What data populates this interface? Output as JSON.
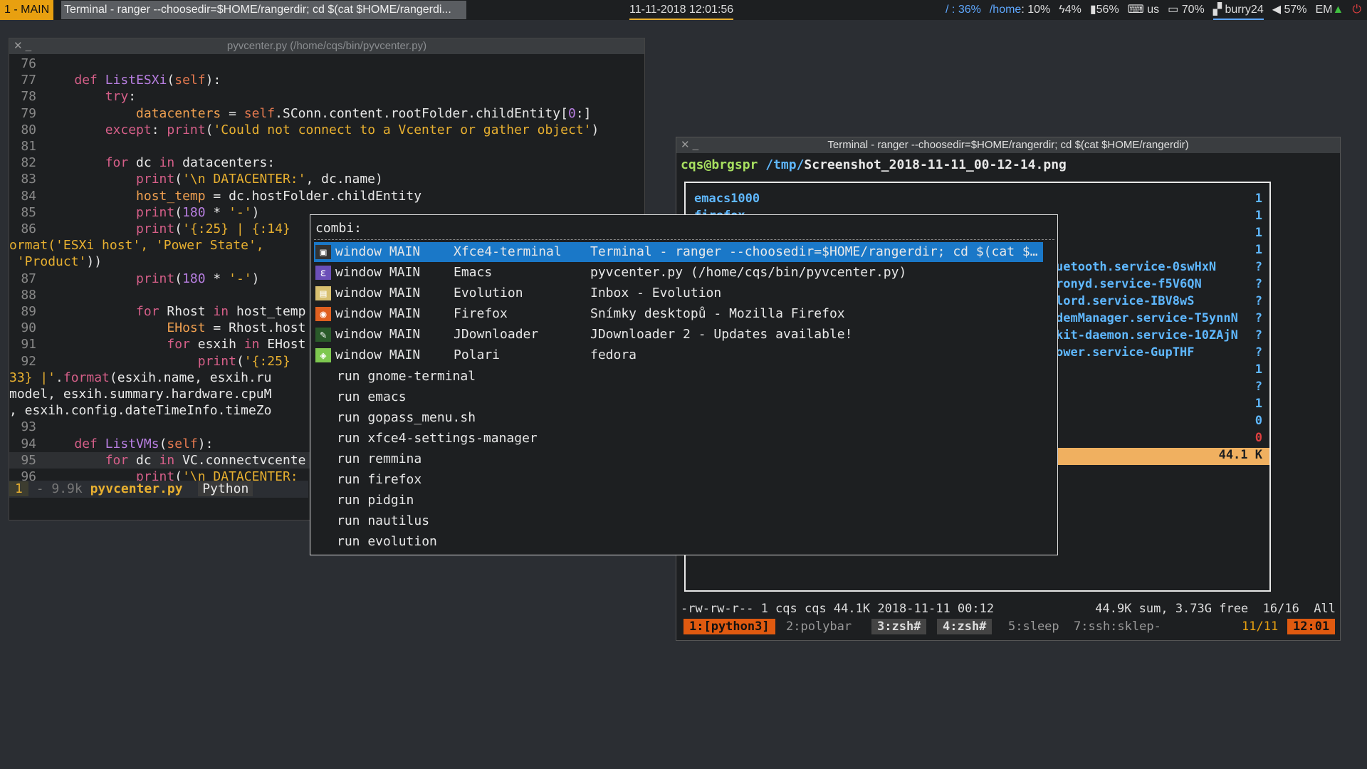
{
  "topbar": {
    "workspace": "1 - MAIN",
    "window_title": "Terminal - ranger --choosedir=$HOME/rangerdir; cd $(cat $HOME/rangerdi...",
    "datetime": "11-11-2018 12:01:56",
    "root_label": "/ : 36%",
    "home_label": "/home",
    "home_value": ": 10%",
    "cpu": "4%",
    "memory": "56%",
    "keyboard": "us",
    "battery": "70%",
    "wifi": "burry24",
    "volume": "57%",
    "user": "EM"
  },
  "emacs": {
    "title": "pyvcenter.py (/home/cqs/bin/pyvcenter.py)",
    "modeline": {
      "num": "1",
      "size": "- 9.9k",
      "file": "pyvcenter.py",
      "mode": "Python"
    },
    "lines": [
      {
        "n": "76",
        "html": ""
      },
      {
        "n": "77",
        "html": "    <span class='kw'>def</span> <span class='fn'>ListESXi</span>(<span class='sf'>self</span>):"
      },
      {
        "n": "78",
        "html": "        <span class='kw'>try</span>:"
      },
      {
        "n": "79",
        "html": "            <span class='vr'>datacenters</span> = <span class='sf'>self</span>.SConn.content.rootFolder.childEntity[<span class='fn'>0</span>:]"
      },
      {
        "n": "80",
        "html": "        <span class='kw'>except</span>: <span class='kw'>print</span>(<span class='st'>'Could not connect to a Vcenter or gather object'</span>)"
      },
      {
        "n": "81",
        "html": ""
      },
      {
        "n": "82",
        "html": "        <span class='kw'>for</span> dc <span class='kw'>in</span> datacenters:"
      },
      {
        "n": "83",
        "html": "            <span class='kw'>print</span>(<span class='st'>'\\n DATACENTER:'</span>, dc.name)"
      },
      {
        "n": "84",
        "html": "            <span class='vr'>host_temp</span> = dc.hostFolder.childEntity"
      },
      {
        "n": "85",
        "html": "            <span class='kw'>print</span>(<span class='fn'>180</span> * <span class='st'>'-'</span>)"
      },
      {
        "n": "86",
        "html": "            <span class='kw'>print</span>(<span class='st'>'{:25} | {:14}</span>"
      },
      {
        "n": "",
        "html": "<span class='st'>ormat('ESXi host', 'Power State',</span>"
      },
      {
        "n": "",
        "html": " <span class='st'>'Product'</span>))"
      },
      {
        "n": "87",
        "html": "            <span class='kw'>print</span>(<span class='fn'>180</span> * <span class='st'>'-'</span>)"
      },
      {
        "n": "88",
        "html": ""
      },
      {
        "n": "89",
        "html": "            <span class='kw'>for</span> Rhost <span class='kw'>in</span> host_temp"
      },
      {
        "n": "90",
        "html": "                <span class='vr'>EHost</span> = Rhost.host"
      },
      {
        "n": "91",
        "html": "                <span class='kw'>for</span> esxih <span class='kw'>in</span> EHost"
      },
      {
        "n": "92",
        "html": "                    <span class='kw'>print</span>(<span class='st'>'{:25}</span>"
      },
      {
        "n": "",
        "html": "<span class='st'>33} |'</span>.<span class='kw'>format</span>(esxih.name, esxih.ru"
      },
      {
        "n": "",
        "html": "model, esxih.summary.hardware.cpuM"
      },
      {
        "n": "",
        "html": ", esxih.config.dateTimeInfo.timeZo"
      },
      {
        "n": "93",
        "html": ""
      },
      {
        "n": "94",
        "html": "    <span class='kw'>def</span> <span class='fn'>ListVMs</span>(<span class='sf'>self</span>):"
      },
      {
        "n": "95",
        "html": "        <span class='kw'>for</span> dc <span class='kw'>in</span> VC.connectvcente"
      },
      {
        "n": "96",
        "html": "            <span class='kw'>print</span>(<span class='st'>'\\n DATACENTER:</span>"
      }
    ]
  },
  "terminal": {
    "title": "Terminal - ranger --choosedir=$HOME/rangerdir; cd $(cat $HOME/rangerdir)",
    "prompt_user": "cqs@brgspr",
    "prompt_path": "/tmp/",
    "prompt_file": "Screenshot_2018-11-11_00-12-14.png",
    "ranger_rows": [
      {
        "name": "emacs1000",
        "count": "1"
      },
      {
        "name": "firefox",
        "count": "1"
      },
      {
        "name": "",
        "count": "1"
      },
      {
        "name": "",
        "count": "1"
      },
      {
        "name": "uetooth.service-0swHxN",
        "count": "?"
      },
      {
        "name": "ronyd.service-f5V6QN",
        "count": "?"
      },
      {
        "name": "lord.service-IBV8wS",
        "count": "?"
      },
      {
        "name": "demManager.service-T5ynnN",
        "count": "?"
      },
      {
        "name": "kit-daemon.service-10ZAjN",
        "count": "?"
      },
      {
        "name": "ower.service-GupTHF",
        "count": "?"
      },
      {
        "name": "",
        "count": "1"
      },
      {
        "name": "",
        "count": "?"
      },
      {
        "name": "",
        "count": "1"
      },
      {
        "name": "",
        "count": "0"
      },
      {
        "name": "",
        "count": "0"
      },
      {
        "name": "",
        "count": "44.1 K"
      }
    ],
    "file_info": "-rw-rw-r-- 1 cqs cqs 44.1K 2018-11-11 00:12",
    "file_info_right": "44.9K sum, 3.73G free  16/16  All",
    "tmux": {
      "w1": "1:[python3]",
      "w2": "2:polybar",
      "w3": "3:zsh#",
      "w4": "4:zsh#",
      "w5": "5:sleep",
      "w7": "7:ssh:sklep-",
      "date": "11/11",
      "time": "12:01"
    }
  },
  "rofi": {
    "prompt": "combi:",
    "windows": [
      {
        "c1": "window MAIN",
        "c2": "Xfce4-terminal",
        "c3": "Terminal - ranger --choosedir=$HOME/rangerdir; cd $(cat $…",
        "icon": "terminal-icon"
      },
      {
        "c1": "window MAIN",
        "c2": "Emacs",
        "c3": "pyvcenter.py (/home/cqs/bin/pyvcenter.py)",
        "icon": "emacs-icon"
      },
      {
        "c1": "window MAIN",
        "c2": "Evolution",
        "c3": "Inbox - Evolution",
        "icon": "evolution-icon"
      },
      {
        "c1": "window MAIN",
        "c2": "Firefox",
        "c3": "Snímky desktopů - Mozilla Firefox",
        "icon": "firefox-icon"
      },
      {
        "c1": "window MAIN",
        "c2": "JDownloader",
        "c3": "JDownloader 2 - Updates available!",
        "icon": "jdownloader-icon"
      },
      {
        "c1": "window MAIN",
        "c2": "Polari",
        "c3": "fedora",
        "icon": "polari-icon"
      }
    ],
    "runs": [
      "run gnome-terminal",
      "run emacs",
      "run gopass_menu.sh",
      "run xfce4-settings-manager",
      "run remmina",
      "run firefox",
      "run pidgin",
      "run nautilus",
      "run evolution"
    ]
  },
  "colors": {
    "accent": "#e8a010",
    "selection": "#1a78c8",
    "link": "#5fb8ff"
  }
}
